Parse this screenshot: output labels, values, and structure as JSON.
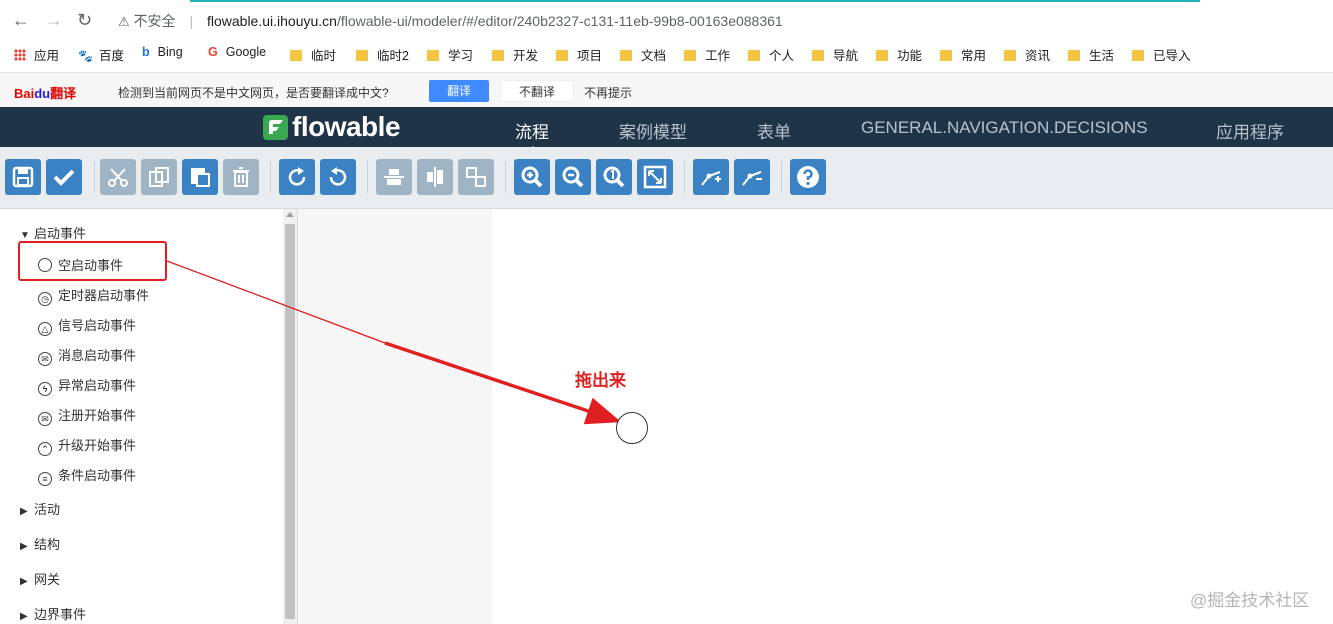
{
  "browser": {
    "security_label": "不安全",
    "url_host": "flowable.ui.ihouyu.cn",
    "url_path": "/flowable-ui/modeler/#/editor/240b2327-c131-11eb-99b8-00163e088361"
  },
  "bookmarks": [
    "应用",
    "百度",
    "Bing",
    "Google",
    "临时",
    "临时2",
    "学习",
    "开发",
    "项目",
    "文档",
    "工作",
    "个人",
    "导航",
    "功能",
    "常用",
    "资讯",
    "生活",
    "已导入"
  ],
  "translate_bar": {
    "logo_bai": "Bai",
    "logo_du": "du",
    "logo_trans": "翻译",
    "message": "检测到当前网页不是中文网页，是否要翻译成中文?",
    "translate": "翻译",
    "no_translate": "不翻译",
    "no_prompt": "不再提示"
  },
  "header": {
    "logo": "flowable",
    "nav": [
      "流程",
      "案例模型",
      "表单",
      "GENERAL.NAVIGATION.DECISIONS",
      "应用程序"
    ],
    "active_index": 0
  },
  "toolbar": {
    "buttons": [
      {
        "name": "save-icon",
        "enabled": true
      },
      {
        "name": "validate-icon",
        "enabled": true
      },
      {
        "name": "cut-icon",
        "enabled": false
      },
      {
        "name": "copy-icon",
        "enabled": false
      },
      {
        "name": "paste-icon",
        "enabled": true
      },
      {
        "name": "delete-icon",
        "enabled": false
      },
      {
        "name": "redo-icon",
        "enabled": true
      },
      {
        "name": "undo-icon",
        "enabled": true
      },
      {
        "name": "align-horizontal-icon",
        "enabled": false
      },
      {
        "name": "align-vertical-icon",
        "enabled": false
      },
      {
        "name": "same-size-icon",
        "enabled": false
      },
      {
        "name": "zoom-in-icon",
        "enabled": true
      },
      {
        "name": "zoom-out-icon",
        "enabled": true
      },
      {
        "name": "zoom-actual-icon",
        "enabled": true
      },
      {
        "name": "zoom-fit-icon",
        "enabled": true
      },
      {
        "name": "add-bendpoint-icon",
        "enabled": true
      },
      {
        "name": "remove-bendpoint-icon",
        "enabled": true
      },
      {
        "name": "help-icon",
        "enabled": true
      }
    ],
    "colors": {
      "enabled": "#3a82c4",
      "disabled": "#9fb4c4"
    }
  },
  "palette": {
    "expanded_group": "启动事件",
    "items": [
      {
        "label": "空启动事件",
        "icon": "none-start-icon"
      },
      {
        "label": "定时器启动事件",
        "icon": "timer-start-icon"
      },
      {
        "label": "信号启动事件",
        "icon": "signal-start-icon"
      },
      {
        "label": "消息启动事件",
        "icon": "message-start-icon"
      },
      {
        "label": "异常启动事件",
        "icon": "error-start-icon"
      },
      {
        "label": "注册开始事件",
        "icon": "registry-start-icon"
      },
      {
        "label": "升级开始事件",
        "icon": "escalation-start-icon"
      },
      {
        "label": "条件启动事件",
        "icon": "conditional-start-icon"
      }
    ],
    "collapsed_groups": [
      "活动",
      "结构",
      "网关",
      "边界事件"
    ]
  },
  "annotation": {
    "text": "拖出来",
    "color": "#e02020"
  },
  "watermark": "@掘金技术社区"
}
